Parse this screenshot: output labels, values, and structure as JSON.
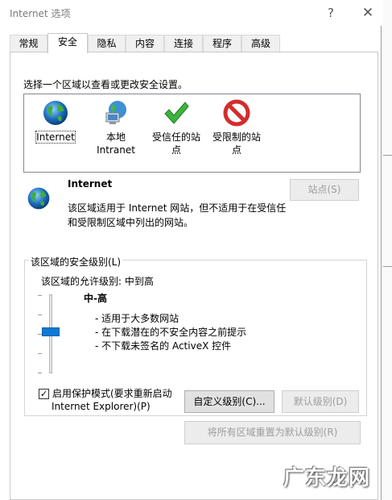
{
  "window": {
    "title": "Internet 选项",
    "help_glyph": "?",
    "close_glyph": "✕"
  },
  "tabs": [
    {
      "label": "常规"
    },
    {
      "label": "安全",
      "active": true
    },
    {
      "label": "隐私"
    },
    {
      "label": "内容"
    },
    {
      "label": "连接"
    },
    {
      "label": "程序"
    },
    {
      "label": "高级"
    }
  ],
  "security": {
    "select_zone_label": "选择一个区域以查看或更改安全设置。",
    "zones": [
      {
        "label_line1": "Internet",
        "label_line2": "",
        "icon": "globe-icon",
        "selected": true
      },
      {
        "label_line1": "本地",
        "label_line2": "Intranet",
        "icon": "intranet-icon"
      },
      {
        "label_line1": "受信任的站",
        "label_line2": "点",
        "icon": "green-checkmark-icon"
      },
      {
        "label_line1": "受限制的站",
        "label_line2": "点",
        "icon": "red-prohibited-icon"
      }
    ],
    "zone_info": {
      "title": "Internet",
      "description": "该区域适用于 Internet 网站，但不适用于在受信任和受限制区域中列出的网站。"
    },
    "sites_button": "站点(S)",
    "level_group": {
      "title": "该区域的安全级别(L)",
      "allowed": "该区域的允许级别: 中到高",
      "level_name": "中-高",
      "slider_level": "中-高",
      "items": [
        "- 适用于大多数网站",
        "- 在下载潜在的不安全内容之前提示",
        "- 不下载未签名的 ActiveX 控件"
      ],
      "protected_mode": {
        "checked": true,
        "check_glyph": "✓",
        "label_line1": "启用保护模式(要求重新启动",
        "label_line2": "Internet Explorer)(P)"
      },
      "custom_button": "自定义级别(C)...",
      "default_button": "默认级别(D)"
    },
    "reset_all_button": "将所有区域重置为默认级别(R)"
  },
  "watermark": "广东龙网",
  "colors": {
    "slider_thumb": "#0f7ad6",
    "check_green": "#3cb43c",
    "prohibited_red": "#d42b2b",
    "globe_blue": "#1f6fbf"
  }
}
